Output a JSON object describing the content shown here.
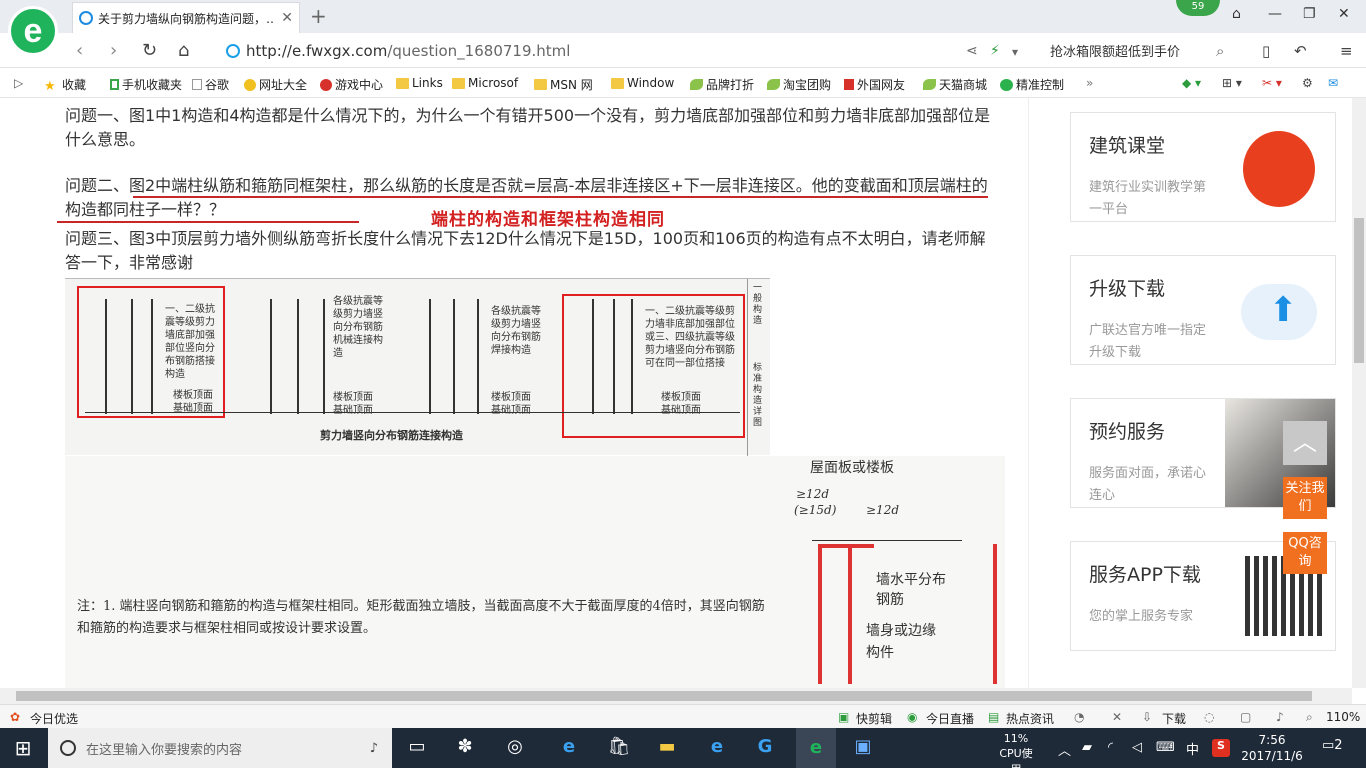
{
  "browser": {
    "logo": "e",
    "tab_title": "关于剪力墙纵向钢筋构造问题，…",
    "close_glyph": "✕",
    "new_tab_glyph": "+",
    "badge": "59",
    "url_domain": "http://e.fwxgx.com",
    "url_path": "/question_1680719.html",
    "promo_text": "抢冰箱限额超低到手价"
  },
  "bookmarks": [
    {
      "label": "收藏",
      "icon": "star-icon"
    },
    {
      "label": "手机收藏夹",
      "icon": "phone-icon"
    },
    {
      "label": "谷歌",
      "icon": "page-icon"
    },
    {
      "label": "网址大全",
      "icon": "globe-icon"
    },
    {
      "label": "游戏中心",
      "icon": "game-icon"
    },
    {
      "label": "Links",
      "icon": "folder-icon"
    },
    {
      "label": "Microsof",
      "icon": "folder-icon"
    },
    {
      "label": "MSN 网",
      "icon": "folder-icon"
    },
    {
      "label": "Window",
      "icon": "folder-icon"
    },
    {
      "label": "品牌打折",
      "icon": "leaf-icon"
    },
    {
      "label": "淘宝团购",
      "icon": "leaf-icon"
    },
    {
      "label": "外国网友",
      "icon": "flag-icon"
    },
    {
      "label": "天猫商城",
      "icon": "leaf-icon"
    },
    {
      "label": "精准控制",
      "icon": "chat-icon"
    }
  ],
  "article": {
    "q1": "问题一、图1中1构造和4构造都是什么情况下的，为什么一个有错开500一个没有，剪力墙底部加强部位和剪力墙非底部加强部位是什么意思。",
    "q2": "问题二、图2中端柱纵筋和箍筋同框架柱，那么纵筋的长度是否就=层高-本层非连接区+下一层非连接区。他的变截面和顶层端柱的构造都同柱子一样？？",
    "q3": "问题三、图3中顶层剪力墙外侧纵筋弯折长度什么情况下去12D什么情况下是15D，100页和106页的构造有点不太明白，请老师解答一下，非常感谢",
    "annotation": "端柱的构造和框架柱构造相同",
    "fig1_caption": "剪力墙竖向分布钢筋连接构造",
    "fig1_b1": "一、二级抗震等级剪力墙底部加强部位竖向分布钢筋搭接构造",
    "fig1_b2": "各级抗震等级剪力墙竖向分布钢筋机械连接构造",
    "fig1_b3": "各级抗震等级剪力墙竖向分布钢筋焊接构造",
    "fig1_b4": "一、二级抗震等级剪力墙非底部加强部位或三、四级抗震等级剪力墙竖向分布钢筋可在同一部位搭接",
    "fig1_floor": "楼板顶面 基础顶面",
    "fig1_side1": "一般构造",
    "fig1_side2": "标准构造详图",
    "note": "注：1. 端柱竖向钢筋和箍筋的构造与框架柱相同。矩形截面独立墙肢，当截面高度不大于截面厚度的4倍时，其竖向钢筋和箍筋的构造要求与框架柱相同或按设计要求设置。",
    "fig2_title": "屋面板或楼板",
    "fig2_d1": "≥12d",
    "fig2_d2": "(≥15d)",
    "fig2_d3": "≥12d",
    "fig2_l1": "墙水平分布钢筋",
    "fig2_l2": "墙身或边缘构件"
  },
  "sidebar": {
    "cards": [
      {
        "title": "建筑课堂",
        "desc": "建筑行业实训教学第一平台"
      },
      {
        "title": "升级下载",
        "desc": "广联达官方唯一指定升级下载"
      },
      {
        "title": "预约服务",
        "desc": "服务面对面，承诺心连心"
      },
      {
        "title": "服务APP下载",
        "desc": "您的掌上服务专家"
      }
    ],
    "follow": "关注我们",
    "qq": "QQ咨询"
  },
  "status": {
    "left": "今日优选",
    "items": [
      "快剪辑",
      "今日直播",
      "热点资讯",
      "下载"
    ],
    "zoom": "110%"
  },
  "taskbar": {
    "search_placeholder": "在这里输入你要搜索的内容",
    "cpu": "11%",
    "cpu_label": "CPU使用",
    "ime": "中",
    "time": "7:56",
    "date": "2017/11/6",
    "notif": "2"
  },
  "colors": {
    "accent": "#1fb45b",
    "annotation": "#d32020",
    "orange": "#f07020"
  }
}
